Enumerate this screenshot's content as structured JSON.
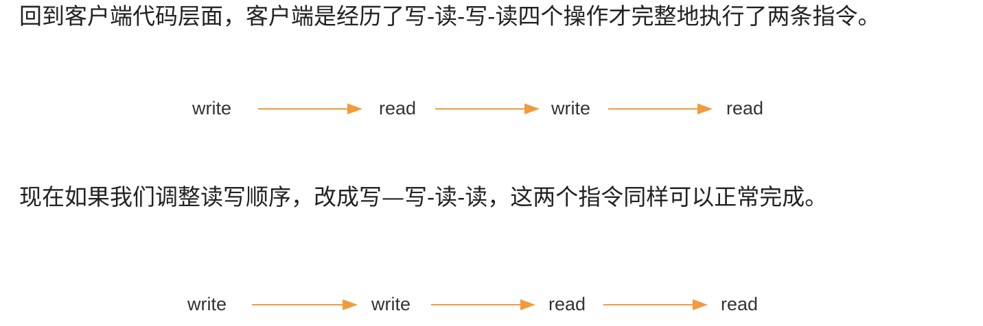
{
  "paragraphs": [
    "回到客户端代码层面，客户端是经历了写-读-写-读四个操作才完整地执行了两条指令。",
    "现在如果我们调整读写顺序，改成写—写-读-读，这两个指令同样可以正常完成。"
  ],
  "flows": [
    {
      "steps": [
        "write",
        "read",
        "write",
        "read"
      ]
    },
    {
      "steps": [
        "write",
        "write",
        "read",
        "read"
      ]
    }
  ],
  "colors": {
    "arrow": "#f39a3c",
    "text": "#222222"
  },
  "icons": [
    "arrow-right-icon"
  ]
}
